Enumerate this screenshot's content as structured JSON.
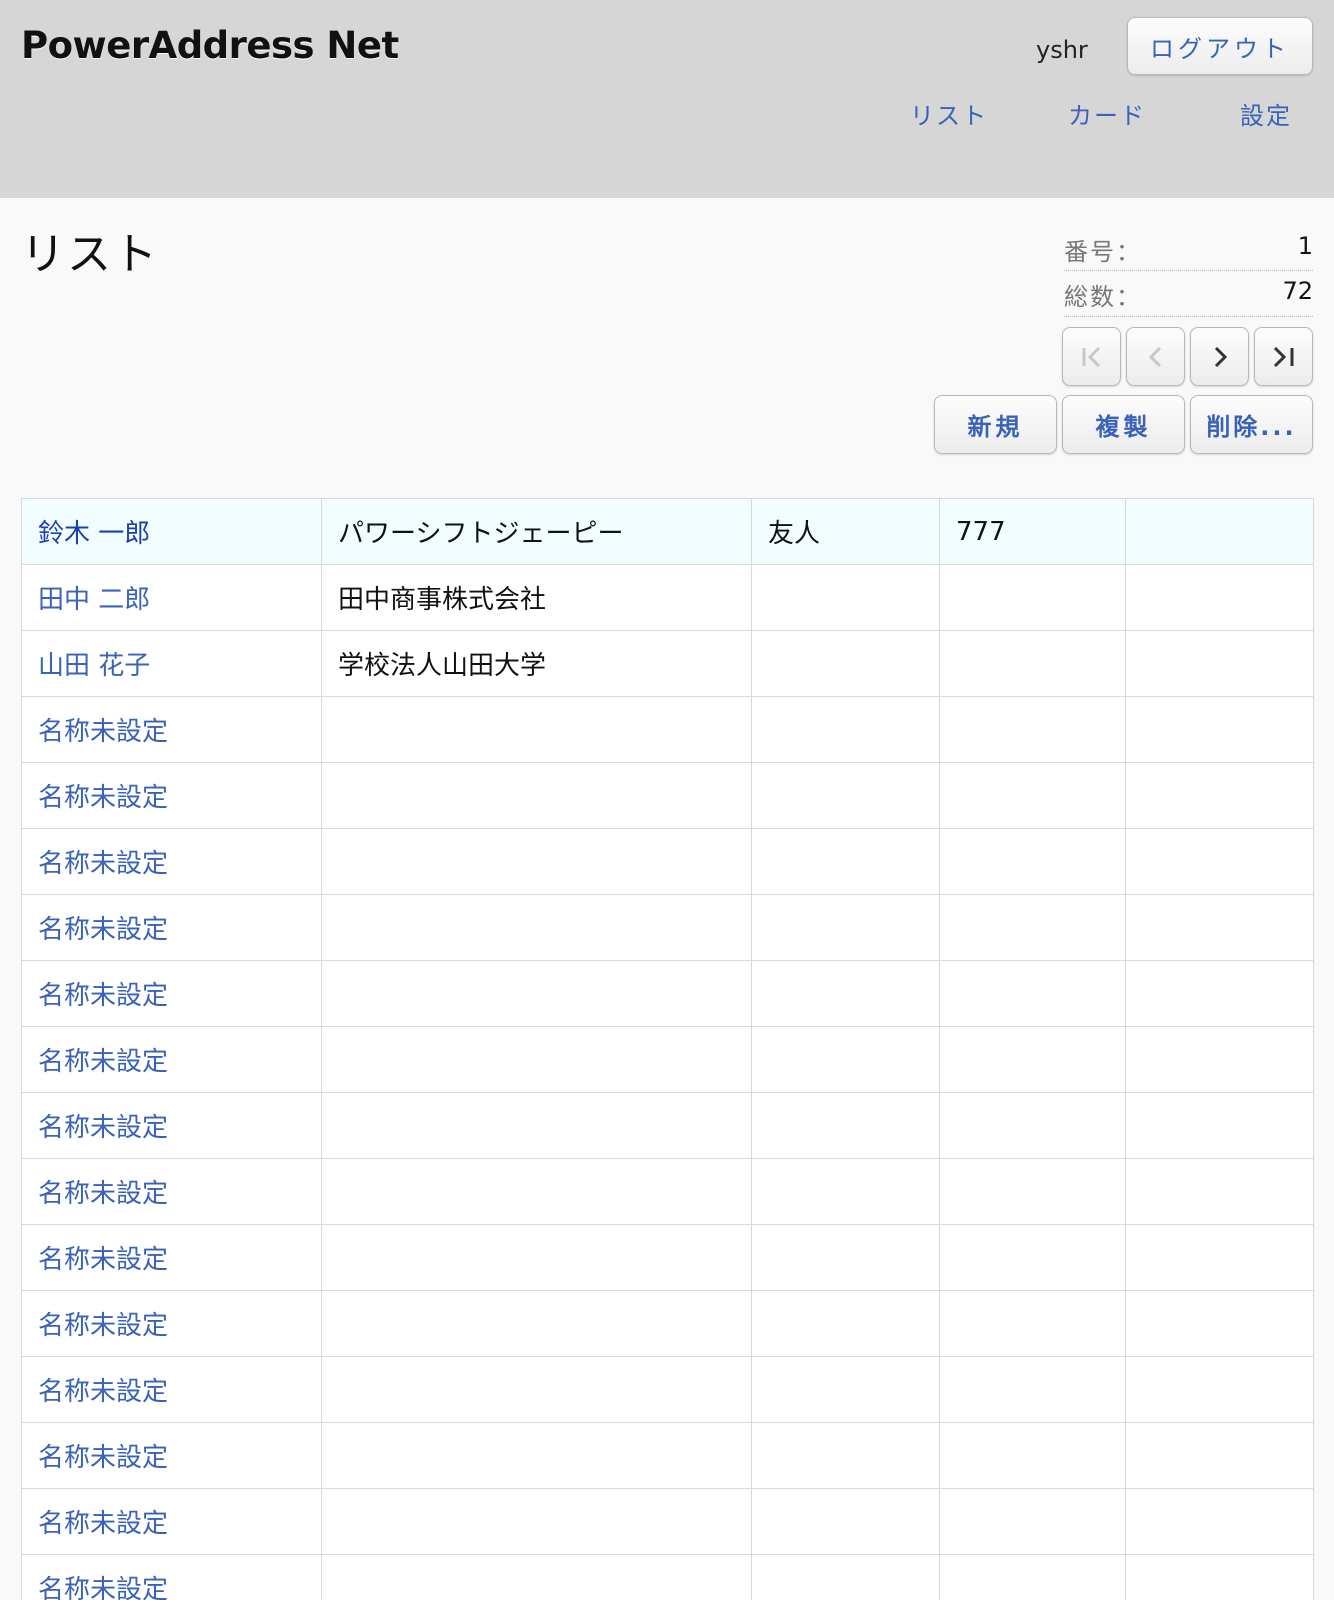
{
  "header": {
    "app_title": "PowerAddress Net",
    "username": "yshr",
    "logout_label": "ログアウト",
    "nav": {
      "list": "リスト",
      "card": "カード",
      "settings": "設定"
    }
  },
  "page": {
    "title": "リスト",
    "record_number_label": "番号：",
    "record_number": "1",
    "total_label": "総数：",
    "total": "72"
  },
  "actions": {
    "new": "新規",
    "duplicate": "複製",
    "delete": "削除..."
  },
  "colors": {
    "accent": "#3a62b9",
    "header_bg": "#d6d6d6",
    "selected_row": "#f1fdff"
  },
  "table": {
    "rows": [
      {
        "name": "鈴木 一郎",
        "company": "パワーシフトジェーピー",
        "category": "友人",
        "code": "777",
        "extra": ""
      },
      {
        "name": "田中 二郎",
        "company": "田中商事株式会社",
        "category": "",
        "code": "",
        "extra": ""
      },
      {
        "name": "山田 花子",
        "company": "学校法人山田大学",
        "category": "",
        "code": "",
        "extra": ""
      },
      {
        "name": "名称未設定",
        "company": "",
        "category": "",
        "code": "",
        "extra": ""
      },
      {
        "name": "名称未設定",
        "company": "",
        "category": "",
        "code": "",
        "extra": ""
      },
      {
        "name": "名称未設定",
        "company": "",
        "category": "",
        "code": "",
        "extra": ""
      },
      {
        "name": "名称未設定",
        "company": "",
        "category": "",
        "code": "",
        "extra": ""
      },
      {
        "name": "名称未設定",
        "company": "",
        "category": "",
        "code": "",
        "extra": ""
      },
      {
        "name": "名称未設定",
        "company": "",
        "category": "",
        "code": "",
        "extra": ""
      },
      {
        "name": "名称未設定",
        "company": "",
        "category": "",
        "code": "",
        "extra": ""
      },
      {
        "name": "名称未設定",
        "company": "",
        "category": "",
        "code": "",
        "extra": ""
      },
      {
        "name": "名称未設定",
        "company": "",
        "category": "",
        "code": "",
        "extra": ""
      },
      {
        "name": "名称未設定",
        "company": "",
        "category": "",
        "code": "",
        "extra": ""
      },
      {
        "name": "名称未設定",
        "company": "",
        "category": "",
        "code": "",
        "extra": ""
      },
      {
        "name": "名称未設定",
        "company": "",
        "category": "",
        "code": "",
        "extra": ""
      },
      {
        "name": "名称未設定",
        "company": "",
        "category": "",
        "code": "",
        "extra": ""
      },
      {
        "name": "名称未設定",
        "company": "",
        "category": "",
        "code": "",
        "extra": ""
      }
    ]
  }
}
